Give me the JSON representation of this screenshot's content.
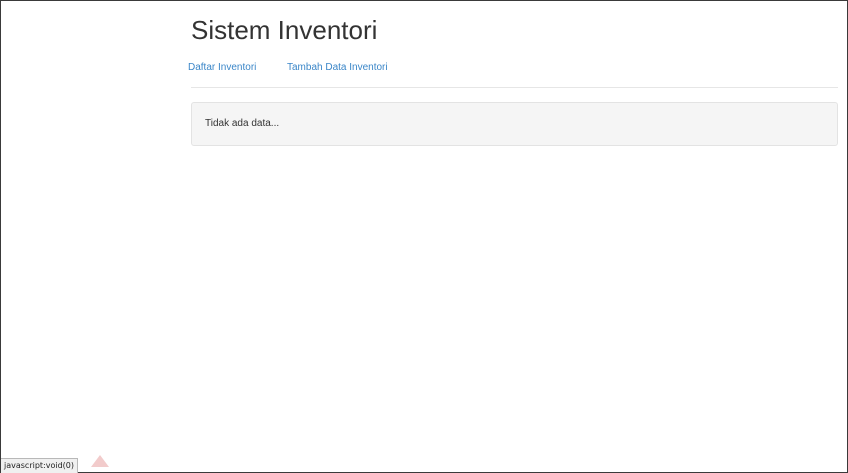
{
  "header": {
    "title": "Sistem Inventori"
  },
  "nav": {
    "items": [
      {
        "label": "Daftar Inventori"
      },
      {
        "label": "Tambah Data Inventori"
      }
    ]
  },
  "main": {
    "empty_message": "Tidak ada data..."
  },
  "statusbar": {
    "text": "javascript:void(0)"
  },
  "colors": {
    "link": "#3a86c8",
    "text": "#333333",
    "well_bg": "#f5f5f5"
  }
}
